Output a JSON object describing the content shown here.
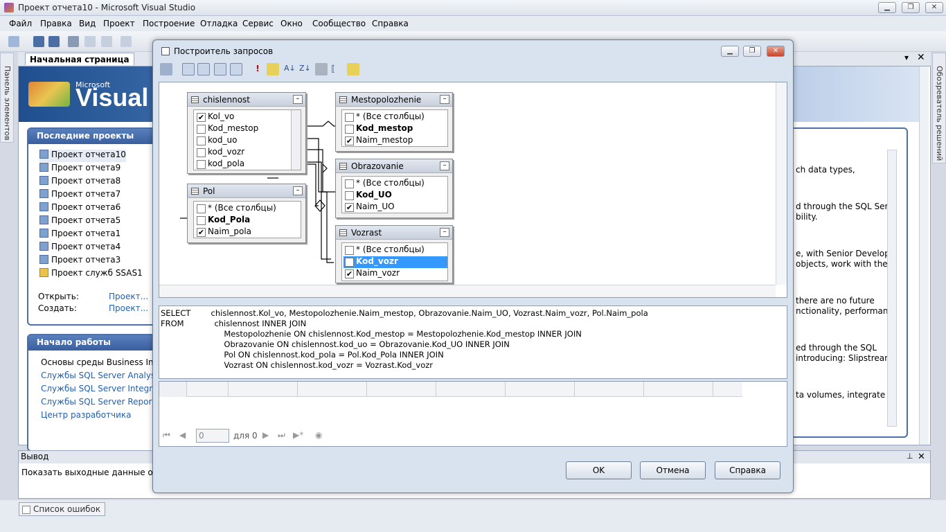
{
  "window": {
    "title": "Проект отчета10 - Microsoft Visual Studio",
    "min": "▁",
    "max": "❐",
    "close": "✕"
  },
  "menu": [
    "Файл",
    "Правка",
    "Вид",
    "Проект",
    "Построение",
    "Отладка",
    "Сервис",
    "Окно",
    "Сообщество",
    "Справка"
  ],
  "left_strip": {
    "label": "Панель элементов"
  },
  "right_strip": {
    "label": "Обозреватель решений"
  },
  "doc_tab": {
    "label": "Начальная страница"
  },
  "banner": {
    "brand_small": "Microsoft",
    "brand_large": "Visual St"
  },
  "recent": {
    "header": "Последние проекты",
    "items": [
      "Проект отчета10",
      "Проект отчета9",
      "Проект отчета8",
      "Проект отчета7",
      "Проект отчета6",
      "Проект отчета5",
      "Проект отчета1",
      "Проект отчета4",
      "Проект отчета3",
      "Проект служб SSAS1"
    ],
    "open_label": "Открыть:",
    "open_link": "Проект...",
    "create_label": "Создать:",
    "create_link": "Проект..."
  },
  "getting_started": {
    "header": "Начало работы",
    "items": [
      "Основы среды Business Intelli",
      "Службы SQL Server Analysis S",
      "Службы SQL Server Integratio",
      "Службы SQL Server Reporting",
      "Центр разработчика"
    ]
  },
  "news_fragments": [
    "ch data types,",
    "d through the SQL Server",
    "bility.",
    "e, with Senior Developer",
    "objects, work with the",
    "there are no future",
    "nctionality, performance",
    "ed through the SQL",
    "introducing: Slipstream,",
    "ta volumes, integrate"
  ],
  "output": {
    "title": "Вывод",
    "show_label": "Показать выходные данные от:"
  },
  "status": {
    "error_list": "Список ошибок"
  },
  "dialog": {
    "title": "Построитель запросов",
    "tables": {
      "chislennost": {
        "name": "chislennost",
        "rows": [
          {
            "label": "Kol_vo",
            "checked": true,
            "bold": false
          },
          {
            "label": "Kod_mestop",
            "checked": false,
            "bold": false
          },
          {
            "label": "kod_uo",
            "checked": false,
            "bold": false
          },
          {
            "label": "kod_vozr",
            "checked": false,
            "bold": false
          },
          {
            "label": "kod_pola",
            "checked": false,
            "bold": false
          }
        ]
      },
      "pol": {
        "name": "Pol",
        "rows": [
          {
            "label": "* (Все столбцы)",
            "checked": false,
            "bold": false
          },
          {
            "label": "Kod_Pola",
            "checked": false,
            "bold": true
          },
          {
            "label": "Naim_pola",
            "checked": true,
            "bold": false
          }
        ]
      },
      "mestopolozhenie": {
        "name": "Mestopolozhenie",
        "rows": [
          {
            "label": "* (Все столбцы)",
            "checked": false,
            "bold": false
          },
          {
            "label": "Kod_mestop",
            "checked": false,
            "bold": true
          },
          {
            "label": "Naim_mestop",
            "checked": true,
            "bold": false
          }
        ]
      },
      "obrazovanie": {
        "name": "Obrazovanie",
        "rows": [
          {
            "label": "* (Все столбцы)",
            "checked": false,
            "bold": false
          },
          {
            "label": "Kod_UO",
            "checked": false,
            "bold": true
          },
          {
            "label": "Naim_UO",
            "checked": true,
            "bold": false
          }
        ]
      },
      "vozrast": {
        "name": "Vozrast",
        "rows": [
          {
            "label": "* (Все столбцы)",
            "checked": false,
            "bold": false
          },
          {
            "label": "Kod_vozr",
            "checked": false,
            "bold": true,
            "selected": true
          },
          {
            "label": "Naim_vozr",
            "checked": true,
            "bold": false
          }
        ]
      }
    },
    "sql_lines": [
      "SELECT        chislennost.Kol_vo, Mestopolozhenie.Naim_mestop, Obrazovanie.Naim_UO, Vozrast.Naim_vozr, Pol.Naim_pola",
      "FROM            chislennost INNER JOIN",
      "                         Mestopolozhenie ON chislennost.Kod_mestop = Mestopolozhenie.Kod_mestop INNER JOIN",
      "                         Obrazovanie ON chislennost.kod_uo = Obrazovanie.Kod_UO INNER JOIN",
      "                         Pol ON chislennost.kod_pola = Pol.Kod_Pola INNER JOIN",
      "                         Vozrast ON chislennost.kod_vozr = Vozrast.Kod_vozr"
    ],
    "nav": {
      "page_value": "0",
      "of_label": "для 0"
    },
    "buttons": {
      "ok": "OK",
      "cancel": "Отмена",
      "help": "Справка"
    }
  }
}
